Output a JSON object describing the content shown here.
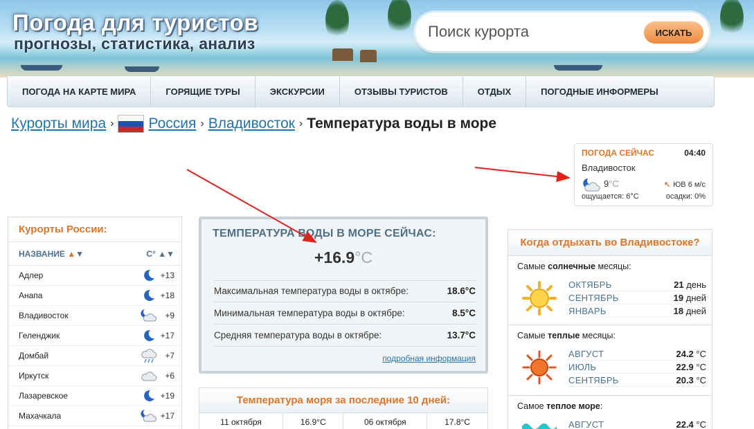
{
  "site": {
    "title": "Погода для туристов",
    "subtitle": "прогнозы, статистика, анализ"
  },
  "search": {
    "placeholder": "Поиск курорта",
    "button": "ИСКАТЬ"
  },
  "nav": [
    "ПОГОДА НА КАРТЕ МИРА",
    "ГОРЯЩИЕ ТУРЫ",
    "ЭКСКУРСИИ",
    "ОТЗЫВЫ ТУРИСТОВ",
    "ОТДЫХ",
    "ПОГОДНЫЕ ИНФОРМЕРЫ"
  ],
  "breadcrumbs": {
    "c1": "Курорты мира",
    "c2": "Россия",
    "c3": "Владивосток",
    "current": "Температура воды в море"
  },
  "weather_now": {
    "heading": "ПОГОДА СЕЙЧАС",
    "time": "04:40",
    "city": "Владивосток",
    "temp": "9",
    "unit": "°C",
    "wind": "ЮВ 6 м/с",
    "feels": "ощущается: 6°C",
    "precip": "осадки: 0%",
    "icon": "moon-cloud-icon"
  },
  "resorts": {
    "title": "Курорты России:",
    "col_name": "НАЗВАНИЕ",
    "col_temp": "C°",
    "items": [
      {
        "name": "Адлер",
        "temp": "+13",
        "icon": "moon"
      },
      {
        "name": "Анапа",
        "temp": "+18",
        "icon": "moon"
      },
      {
        "name": "Владивосток",
        "temp": "+9",
        "icon": "moon-cloud"
      },
      {
        "name": "Геленджик",
        "temp": "+17",
        "icon": "moon"
      },
      {
        "name": "Домбай",
        "temp": "+7",
        "icon": "rain-cloud"
      },
      {
        "name": "Иркутск",
        "temp": "+6",
        "icon": "cloud"
      },
      {
        "name": "Лазаревское",
        "temp": "+19",
        "icon": "moon"
      },
      {
        "name": "Махачкала",
        "temp": "+17",
        "icon": "moon-cloud"
      }
    ]
  },
  "sea": {
    "heading": "ТЕМПЕРАТУРА ВОДЫ В МОРЕ СЕЙЧАС:",
    "value": "+16.9",
    "unit": "°C",
    "stats": [
      {
        "label": "Максимальная температура воды в октябре:",
        "value": "18.6°C"
      },
      {
        "label": "Минимальная температура воды в октябре:",
        "value": "8.5°C"
      },
      {
        "label": "Средняя температура воды в октябре:",
        "value": "13.7°C"
      }
    ],
    "more": "подробная информация"
  },
  "history": {
    "heading": "Температура моря за последние 10 дней:",
    "row": [
      "11 октября",
      "16.9°C",
      "06 октября",
      "17.8°C"
    ]
  },
  "when": {
    "heading": "Когда отдыхать во Владивостоке?",
    "sections": [
      {
        "cap_pre": "Самые ",
        "cap_bold": "солнечные",
        "cap_post": " месяцы:",
        "icon": "sun-icon",
        "rows": [
          {
            "m": "ОКТЯБРЬ",
            "n": "21",
            "u": " день"
          },
          {
            "m": "СЕНТЯБРЬ",
            "n": "19",
            "u": " дней"
          },
          {
            "m": "ЯНВАРЬ",
            "n": "18",
            "u": " дней"
          }
        ]
      },
      {
        "cap_pre": "Самые ",
        "cap_bold": "теплые",
        "cap_post": " месяцы:",
        "icon": "hot-sun-icon",
        "rows": [
          {
            "m": "АВГУСТ",
            "n": "24.2",
            "u": " °C"
          },
          {
            "m": "ИЮЛЬ",
            "n": "22.9",
            "u": " °C"
          },
          {
            "m": "СЕНТЯБРЬ",
            "n": "20.3",
            "u": " °C"
          }
        ]
      },
      {
        "cap_pre": "Самое ",
        "cap_bold": "теплое море",
        "cap_post": ":",
        "icon": "wave-icon",
        "rows": [
          {
            "m": "АВГУСТ",
            "n": "22.4",
            "u": " °C"
          }
        ]
      }
    ]
  }
}
